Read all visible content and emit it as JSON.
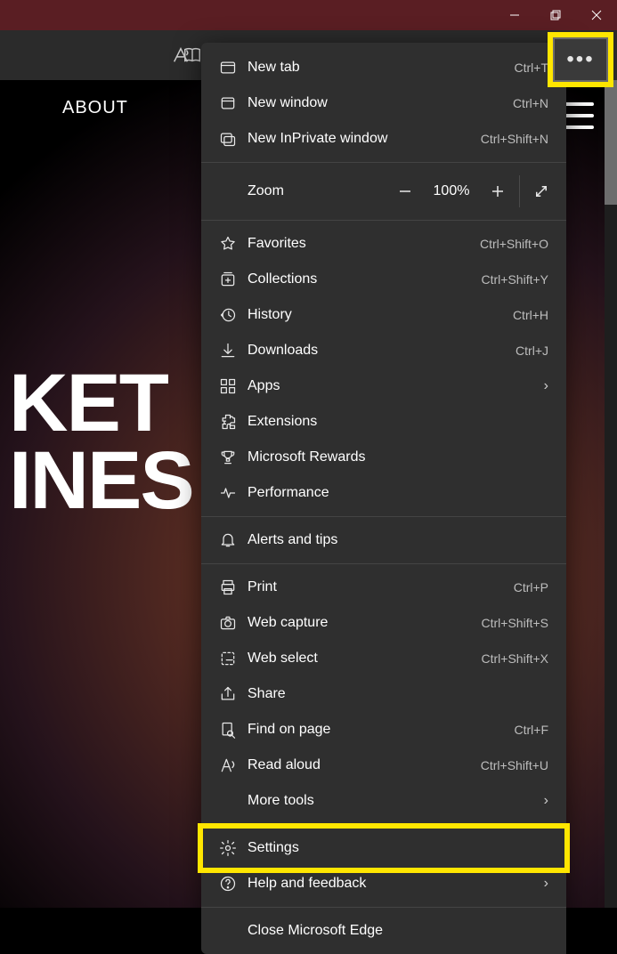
{
  "titlebar": {
    "minimize": "Minimize",
    "maximize": "Restore",
    "close": "Close"
  },
  "toolbar": {
    "read_aloud_icon": "read-aloud",
    "translate_icon": "translate"
  },
  "more_button": {
    "glyph": "•••"
  },
  "page": {
    "nav": {
      "about": "ABOUT"
    },
    "hero_line1": "KET",
    "hero_line2": "INES"
  },
  "menu": {
    "new_tab": {
      "label": "New tab",
      "shortcut": "Ctrl+T"
    },
    "new_window": {
      "label": "New window",
      "shortcut": "Ctrl+N"
    },
    "inprivate": {
      "label": "New InPrivate window",
      "shortcut": "Ctrl+Shift+N"
    },
    "zoom": {
      "label": "Zoom",
      "value": "100%"
    },
    "favorites": {
      "label": "Favorites",
      "shortcut": "Ctrl+Shift+O"
    },
    "collections": {
      "label": "Collections",
      "shortcut": "Ctrl+Shift+Y"
    },
    "history": {
      "label": "History",
      "shortcut": "Ctrl+H"
    },
    "downloads": {
      "label": "Downloads",
      "shortcut": "Ctrl+J"
    },
    "apps": {
      "label": "Apps"
    },
    "extensions": {
      "label": "Extensions"
    },
    "rewards": {
      "label": "Microsoft Rewards"
    },
    "performance": {
      "label": "Performance"
    },
    "alerts": {
      "label": "Alerts and tips"
    },
    "print": {
      "label": "Print",
      "shortcut": "Ctrl+P"
    },
    "web_capture": {
      "label": "Web capture",
      "shortcut": "Ctrl+Shift+S"
    },
    "web_select": {
      "label": "Web select",
      "shortcut": "Ctrl+Shift+X"
    },
    "share": {
      "label": "Share"
    },
    "find": {
      "label": "Find on page",
      "shortcut": "Ctrl+F"
    },
    "read_aloud": {
      "label": "Read aloud",
      "shortcut": "Ctrl+Shift+U"
    },
    "more_tools": {
      "label": "More tools"
    },
    "settings": {
      "label": "Settings"
    },
    "help": {
      "label": "Help and feedback"
    },
    "close_edge": {
      "label": "Close Microsoft Edge"
    }
  }
}
